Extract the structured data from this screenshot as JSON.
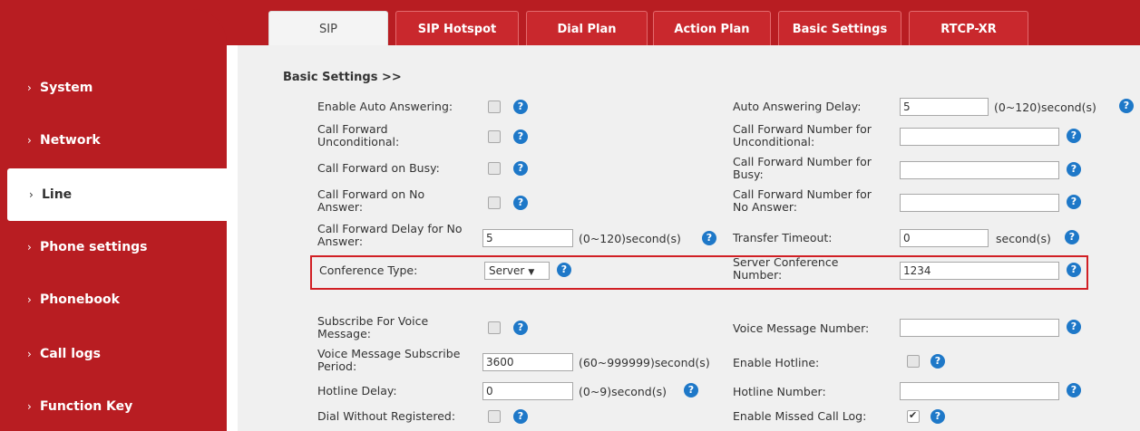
{
  "tabs": [
    {
      "label": "SIP",
      "active": true
    },
    {
      "label": "SIP Hotspot"
    },
    {
      "label": "Dial Plan"
    },
    {
      "label": "Action Plan"
    },
    {
      "label": "Basic Settings"
    },
    {
      "label": "RTCP-XR"
    }
  ],
  "sidebar": {
    "items": [
      {
        "label": "System"
      },
      {
        "label": "Network"
      },
      {
        "label": "Line",
        "active": true
      },
      {
        "label": "Phone settings"
      },
      {
        "label": "Phonebook"
      },
      {
        "label": "Call logs"
      },
      {
        "label": "Function Key"
      }
    ]
  },
  "section_title": "Basic Settings >>",
  "help_glyph": "?",
  "left": {
    "auto_answer": {
      "label": "Enable Auto Answering:",
      "checked": false
    },
    "cfu": {
      "label1": "Call Forward",
      "label2": "Unconditional:",
      "checked": false
    },
    "cfb": {
      "label": "Call Forward on Busy:",
      "checked": false
    },
    "cfna": {
      "label1": "Call Forward on No",
      "label2": "Answer:",
      "checked": false
    },
    "cf_delay": {
      "label1": "Call Forward Delay for No",
      "label2": "Answer:",
      "value": "5",
      "unit": "(0~120)second(s)"
    },
    "conf_type": {
      "label": "Conference Type:",
      "value": "Server",
      "arrow": "▼"
    },
    "subscribe_vm": {
      "label1": "Subscribe For Voice",
      "label2": "Message:",
      "checked": false
    },
    "vm_period": {
      "label1": "Voice Message Subscribe",
      "label2": "Period:",
      "value": "3600",
      "unit": "(60~999999)second(s)"
    },
    "hotline_delay": {
      "label": "Hotline Delay:",
      "value": "0",
      "unit": "(0~9)second(s)"
    },
    "dial_unreg": {
      "label": "Dial Without Registered:",
      "checked": false
    }
  },
  "right": {
    "auto_answer_delay": {
      "label": "Auto Answering Delay:",
      "value": "5",
      "unit": "(0~120)second(s)"
    },
    "cfu_number": {
      "label1": "Call Forward Number for",
      "label2": "Unconditional:",
      "value": ""
    },
    "cfb_number": {
      "label1": "Call Forward Number for",
      "label2": "Busy:",
      "value": ""
    },
    "cfna_number": {
      "label1": "Call Forward Number for",
      "label2": "No Answer:",
      "value": ""
    },
    "transfer_timeout": {
      "label": "Transfer Timeout:",
      "value": "0",
      "unit": "second(s)"
    },
    "server_conf": {
      "label1": "Server Conference",
      "label2": "Number:",
      "value": "1234"
    },
    "vm_number": {
      "label": "Voice Message Number:",
      "value": ""
    },
    "hotline": {
      "label": "Enable Hotline:",
      "checked": false
    },
    "hotline_number": {
      "label": "Hotline Number:",
      "value": ""
    },
    "missed_log": {
      "label": "Enable Missed Call Log:",
      "checked": true
    }
  }
}
